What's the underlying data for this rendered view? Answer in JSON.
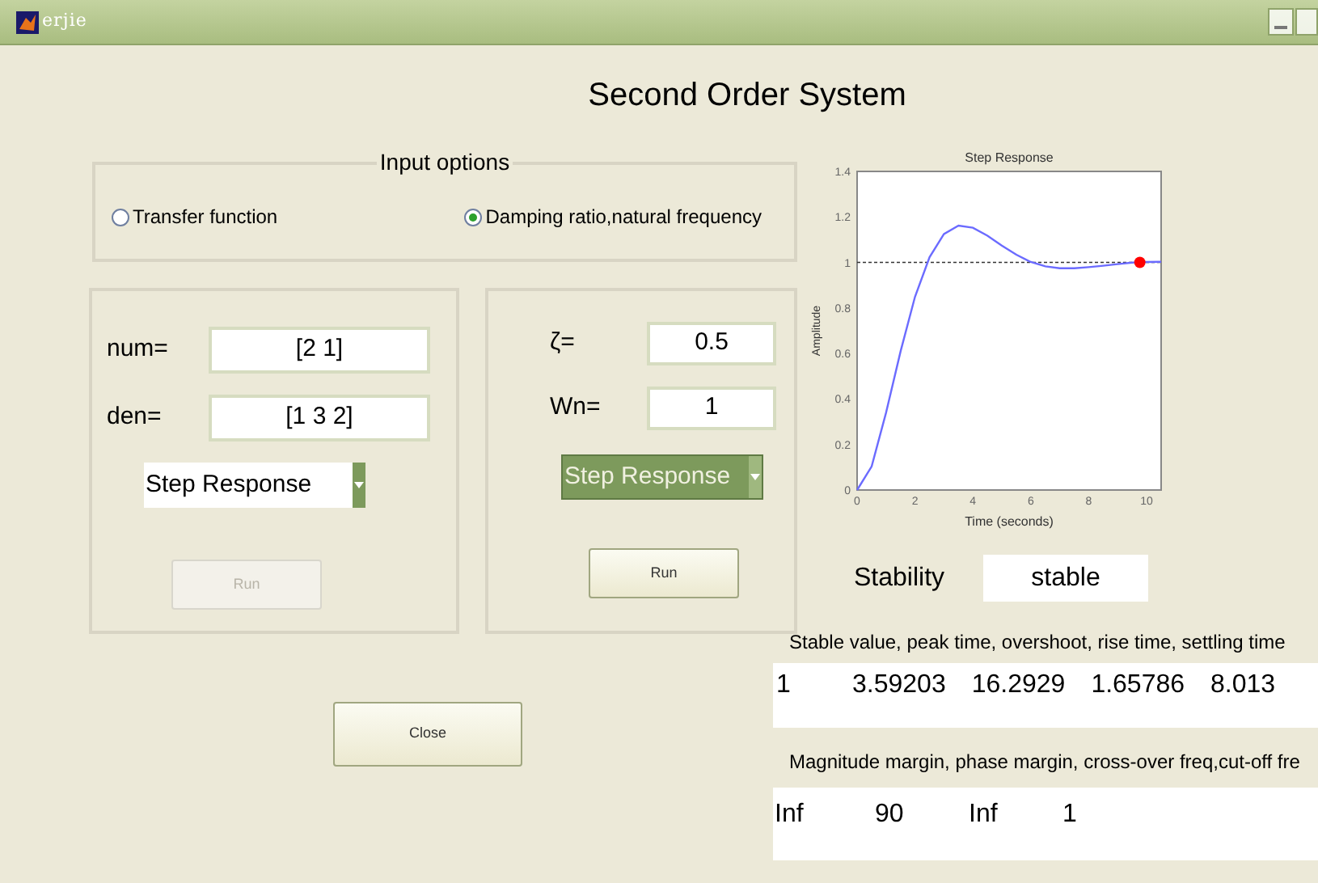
{
  "window": {
    "title": "erjie"
  },
  "heading": "Second Order System",
  "input_options": {
    "title": "Input options",
    "options": [
      {
        "label": "Transfer function",
        "selected": false
      },
      {
        "label": "Damping ratio,natural frequency",
        "selected": true
      }
    ]
  },
  "transfer_panel": {
    "fields": [
      {
        "label": "num=",
        "value": "[2 1]"
      },
      {
        "label": "den=",
        "value": "[1 3 2]"
      }
    ],
    "dropdown": {
      "value": "Step Response",
      "focused": false
    },
    "run_button": {
      "label": "Run",
      "disabled": true
    }
  },
  "damping_panel": {
    "fields": [
      {
        "label": "ζ=",
        "value": "0.5"
      },
      {
        "label": "Wn=",
        "value": "1"
      }
    ],
    "dropdown": {
      "value": "Step Response",
      "focused": true
    },
    "run_button": {
      "label": "Run",
      "disabled": false
    }
  },
  "close_button": {
    "label": "Close"
  },
  "plot": {
    "chart_data": {
      "type": "line",
      "title": "Step Response",
      "xlabel": "Time (seconds)",
      "ylabel": "Amplitude",
      "x": [
        0,
        0.5,
        1,
        1.5,
        2,
        2.5,
        3,
        3.5,
        4,
        4.5,
        5,
        5.5,
        6,
        6.5,
        7,
        7.5,
        8,
        8.5,
        9,
        9.5,
        10,
        10.5
      ],
      "series": [
        {
          "color": "#6b6bff",
          "values": [
            0,
            0.104,
            0.34,
            0.61,
            0.849,
            1.023,
            1.125,
            1.162,
            1.153,
            1.118,
            1.074,
            1.034,
            1.002,
            0.983,
            0.974,
            0.974,
            0.979,
            0.986,
            0.993,
            0.999,
            1.002,
            1.003
          ]
        }
      ],
      "xlim": [
        0,
        10.5
      ],
      "ylim": [
        0,
        1.4
      ],
      "xticks": [
        0,
        2,
        4,
        6,
        8,
        10
      ],
      "yticks": [
        0,
        0.2,
        0.4,
        0.6,
        0.8,
        1,
        1.2,
        1.4
      ]
    }
  },
  "stability": {
    "label": "Stability",
    "value": "stable"
  },
  "time_response": {
    "header": "Stable value, peak time, overshoot, rise time, settling time",
    "values": [
      "1",
      "3.59203",
      "16.2929",
      "1.65786",
      "8.013"
    ]
  },
  "margins": {
    "header": "Magnitude margin, phase margin, cross-over freq,cut-off fre",
    "values": [
      "Inf",
      "90",
      "Inf",
      "1"
    ]
  }
}
